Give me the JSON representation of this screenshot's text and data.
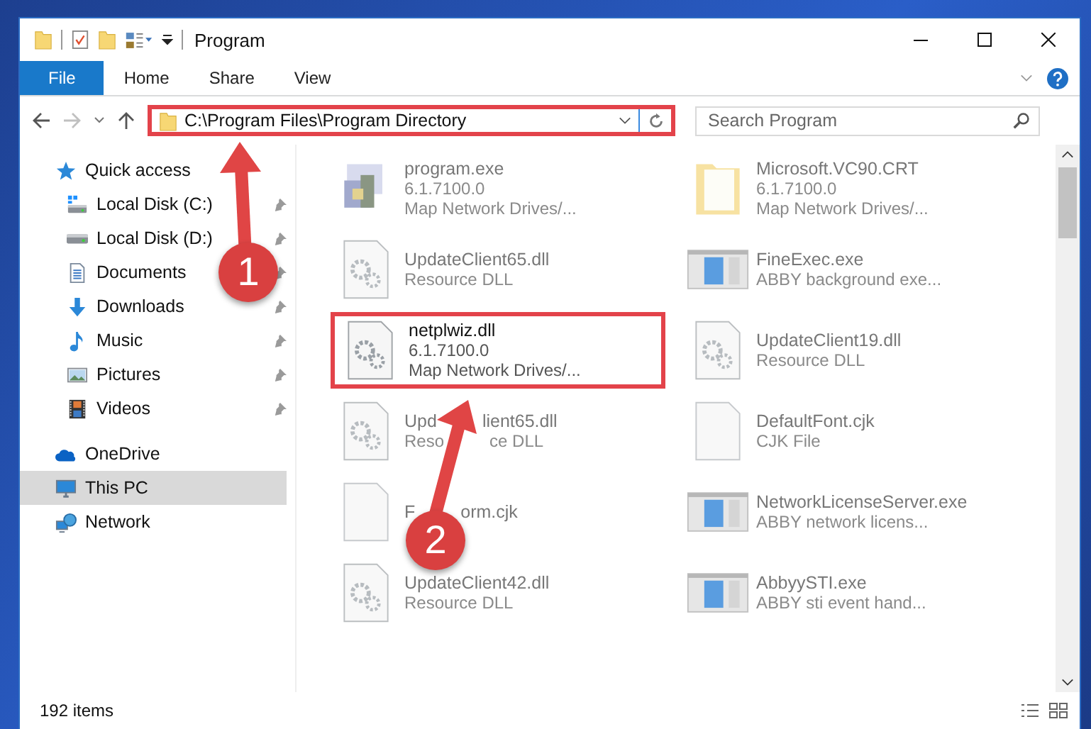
{
  "window": {
    "title": "Program"
  },
  "ribbon": {
    "tabs": [
      {
        "label": "File",
        "selected": true
      },
      {
        "label": "Home",
        "selected": false
      },
      {
        "label": "Share",
        "selected": false
      },
      {
        "label": "View",
        "selected": false
      }
    ]
  },
  "address": {
    "path": "C:\\Program Files\\Program Directory",
    "highlighted": true
  },
  "search": {
    "placeholder": "Search Program"
  },
  "nav_pane": [
    {
      "label": "Quick access",
      "selected": false,
      "children": [
        {
          "label": "Local Disk (C:)",
          "pinned": true,
          "selected": false
        },
        {
          "label": "Local Disk (D:)",
          "pinned": true,
          "selected": false
        },
        {
          "label": "Documents",
          "pinned": true,
          "selected": false
        },
        {
          "label": "Downloads",
          "pinned": true,
          "selected": false
        },
        {
          "label": "Music",
          "pinned": true,
          "selected": false
        },
        {
          "label": "Pictures",
          "pinned": true,
          "selected": false
        },
        {
          "label": "Videos",
          "pinned": true,
          "selected": false
        }
      ]
    },
    {
      "label": "OneDrive",
      "selected": false
    },
    {
      "label": "This PC",
      "selected": true
    },
    {
      "label": "Network",
      "selected": false
    }
  ],
  "files": [
    {
      "name": "program.exe",
      "lines": [
        "6.1.7100.0",
        "Map Network Drives/..."
      ],
      "dimmed": true,
      "highlighted": false
    },
    {
      "name": "Microsoft.VC90.CRT",
      "lines": [
        "6.1.7100.0",
        "Map Network Drives/..."
      ],
      "dimmed": true,
      "highlighted": false
    },
    {
      "name": "UpdateClient65.dll",
      "lines": [
        "Resource DLL"
      ],
      "dimmed": true,
      "highlighted": false
    },
    {
      "name": "FineExec.exe",
      "lines": [
        "ABBY background exe..."
      ],
      "dimmed": true,
      "highlighted": false
    },
    {
      "name": "netplwiz.dll",
      "lines": [
        "6.1.7100.0",
        "Map Network Drives/..."
      ],
      "dimmed": false,
      "highlighted": true
    },
    {
      "name": "UpdateClient19.dll",
      "lines": [
        "Resource DLL"
      ],
      "dimmed": true,
      "highlighted": false
    },
    {
      "name_parts": [
        "Upd",
        "lient65.dll"
      ],
      "line_parts": [
        "Reso",
        "ce DLL"
      ],
      "dimmed": true,
      "highlighted": false
    },
    {
      "name": "DefaultFont.cjk",
      "lines": [
        "CJK File"
      ],
      "dimmed": true,
      "highlighted": false
    },
    {
      "name_parts": [
        "F",
        "orm.cjk"
      ],
      "dimmed": true,
      "highlighted": false
    },
    {
      "name": "NetworkLicenseServer.exe",
      "lines": [
        "ABBY network licens..."
      ],
      "dimmed": true,
      "highlighted": false
    },
    {
      "name": "UpdateClient42.dll",
      "lines": [
        "Resource DLL"
      ],
      "dimmed": true,
      "highlighted": false
    },
    {
      "name": "AbbyySTI.exe",
      "lines": [
        "ABBY sti event hand..."
      ],
      "dimmed": true,
      "highlighted": false
    }
  ],
  "status_bar": {
    "count": "192 items"
  },
  "annotations": [
    "1",
    "2"
  ]
}
